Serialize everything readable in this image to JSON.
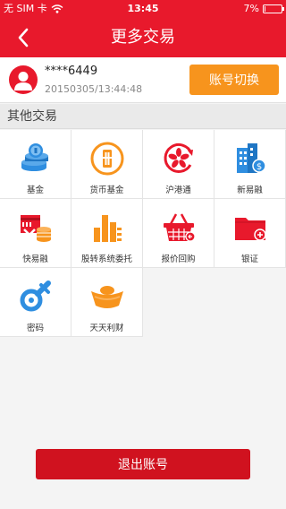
{
  "status_bar": {
    "carrier": "无 SIM 卡",
    "time": "13:45",
    "battery": "7%",
    "battery_level": 0.07
  },
  "header": {
    "title": "更多交易"
  },
  "account": {
    "number": "****6449",
    "login_time": "20150305/13:44:48",
    "switch_label": "账号切换"
  },
  "section": {
    "title": "其他交易"
  },
  "grid": {
    "items": [
      {
        "label": "基金",
        "icon": "coin-stack-icon"
      },
      {
        "label": "货币基金",
        "icon": "money-fund-icon"
      },
      {
        "label": "沪港通",
        "icon": "hk-shanghai-connect-icon"
      },
      {
        "label": "新易融",
        "icon": "building-dollar-icon"
      },
      {
        "label": "快易融",
        "icon": "card-coins-icon"
      },
      {
        "label": "股转系统委托",
        "icon": "bar-chart-icon"
      },
      {
        "label": "报价回购",
        "icon": "basket-icon"
      },
      {
        "label": "银证",
        "icon": "folder-plus-icon"
      },
      {
        "label": "密码",
        "icon": "key-icon"
      },
      {
        "label": "天天利财",
        "icon": "gold-ingot-icon"
      }
    ]
  },
  "footer": {
    "logout_label": "退出账号"
  },
  "colors": {
    "brand_red": "#e8192c",
    "orange": "#f7941d",
    "blue": "#2f8ee0",
    "logout_red": "#d0121f"
  }
}
